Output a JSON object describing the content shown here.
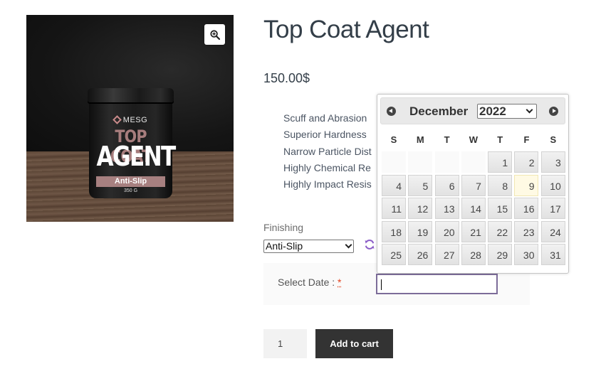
{
  "product": {
    "title": "Top Coat Agent",
    "price": "150.00$",
    "image": {
      "brand": "MESG",
      "line1": "TOP COAT",
      "line2": "AGENT",
      "band": "Anti-Slip",
      "weight": "350 G"
    },
    "features": [
      "Scuff and Abrasion",
      "Superior Hardness",
      "Narrow Particle Dist",
      "Highly Chemical Re",
      "Highly Impact Resis"
    ]
  },
  "finishing": {
    "label": "Finishing",
    "selected": "Anti-Slip"
  },
  "date_field": {
    "label": "Select Date : ",
    "required_mark": "*",
    "value": ""
  },
  "cart": {
    "quantity": "1",
    "add_label": "Add to cart"
  },
  "datepicker": {
    "month": "December",
    "year": "2022",
    "weekdays": [
      "S",
      "M",
      "T",
      "W",
      "T",
      "F",
      "S"
    ],
    "today": "9",
    "weeks": [
      [
        "",
        "",
        "",
        "",
        "1",
        "2",
        "3"
      ],
      [
        "4",
        "5",
        "6",
        "7",
        "8",
        "9",
        "10"
      ],
      [
        "11",
        "12",
        "13",
        "14",
        "15",
        "16",
        "17"
      ],
      [
        "18",
        "19",
        "20",
        "21",
        "22",
        "23",
        "24"
      ],
      [
        "25",
        "26",
        "27",
        "28",
        "29",
        "30",
        "31"
      ]
    ]
  },
  "icons": {
    "zoom": "magnifier-plus-icon",
    "reset": "refresh-icon",
    "prev": "prev-month-icon",
    "next": "next-month-icon"
  },
  "colors": {
    "accent": "#7c6c99",
    "button": "#333333",
    "today_highlight": "#fffae4"
  }
}
